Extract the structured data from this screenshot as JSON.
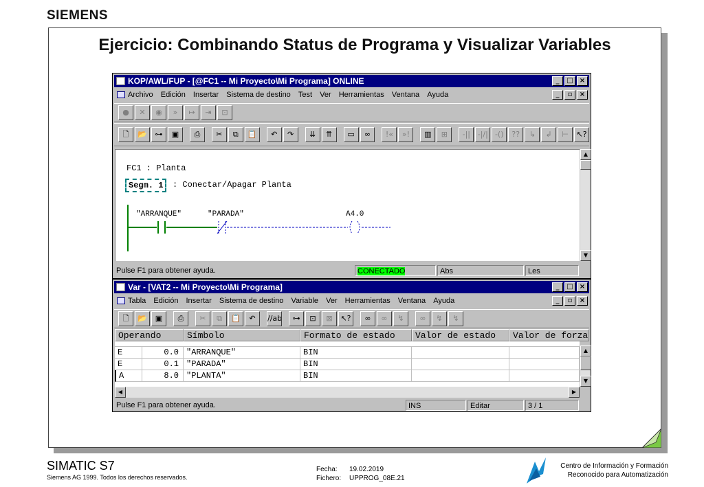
{
  "brand": "SIEMENS",
  "slide_title": "Ejercicio: Combinando Status de Programa y Visualizar Variables",
  "kop_window": {
    "title": "KOP/AWL/FUP  - [@FC1 -- Mi Proyecto\\Mi Programa]  ONLINE",
    "menu": [
      "Archivo",
      "Edición",
      "Insertar",
      "Sistema de destino",
      "Test",
      "Ver",
      "Herramientas",
      "Ventana",
      "Ayuda"
    ],
    "block_title": "FC1 : Planta",
    "network_label": "Segm. 1",
    "network_comment": ": Conectar/Apagar Planta",
    "contact1": "\"ARRANQUE\"",
    "contact2": "\"PARADA\"",
    "coil": "A4.0",
    "status": {
      "help": "Pulse F1 para obtener ayuda.",
      "connected": "CONECTADO",
      "mode": "Abs",
      "access": "Les"
    }
  },
  "var_window": {
    "title": "Var - [VAT2 -- Mi Proyecto\\Mi Programa]",
    "menu": [
      "Tabla",
      "Edición",
      "Insertar",
      "Sistema de destino",
      "Variable",
      "Ver",
      "Herramientas",
      "Ventana",
      "Ayuda"
    ],
    "columns": [
      "Operando",
      "Símbolo",
      "Formato de estado",
      "Valor de estado",
      "Valor de forzado"
    ],
    "rows": [
      {
        "area": "E",
        "address": "0.0",
        "symbol": "\"ARRANQUE\"",
        "format": "BIN",
        "value": "",
        "force": ""
      },
      {
        "area": "E",
        "address": "0.1",
        "symbol": "\"PARADA\"",
        "format": "BIN",
        "value": "",
        "force": ""
      },
      {
        "area": "A",
        "address": "8.0",
        "symbol": "\"PLANTA\"",
        "format": "BIN",
        "value": "",
        "force": ""
      }
    ],
    "status": {
      "help": "Pulse F1 para obtener ayuda.",
      "ins": "INS",
      "edit": "Editar",
      "position": "3 / 1"
    }
  },
  "footer": {
    "product": "SIMATIC S7",
    "copyright": "Siemens AG 1999. Todos los derechos reservados.",
    "date_label": "Fecha:",
    "date_value": "19.02.2019",
    "file_label": "Fichero:",
    "file_value": "UPPROG_08E.21",
    "center_line1": "Centro de Información y Formación",
    "center_line2": "Reconocido para Automatización"
  },
  "colors": {
    "titlebar": "#000080",
    "connected_bg": "#00ff00",
    "window_bg": "#c0c0c0",
    "ladder_green": "#008000",
    "ladder_blue": "#0000c0",
    "dogear": "#7ac943"
  }
}
